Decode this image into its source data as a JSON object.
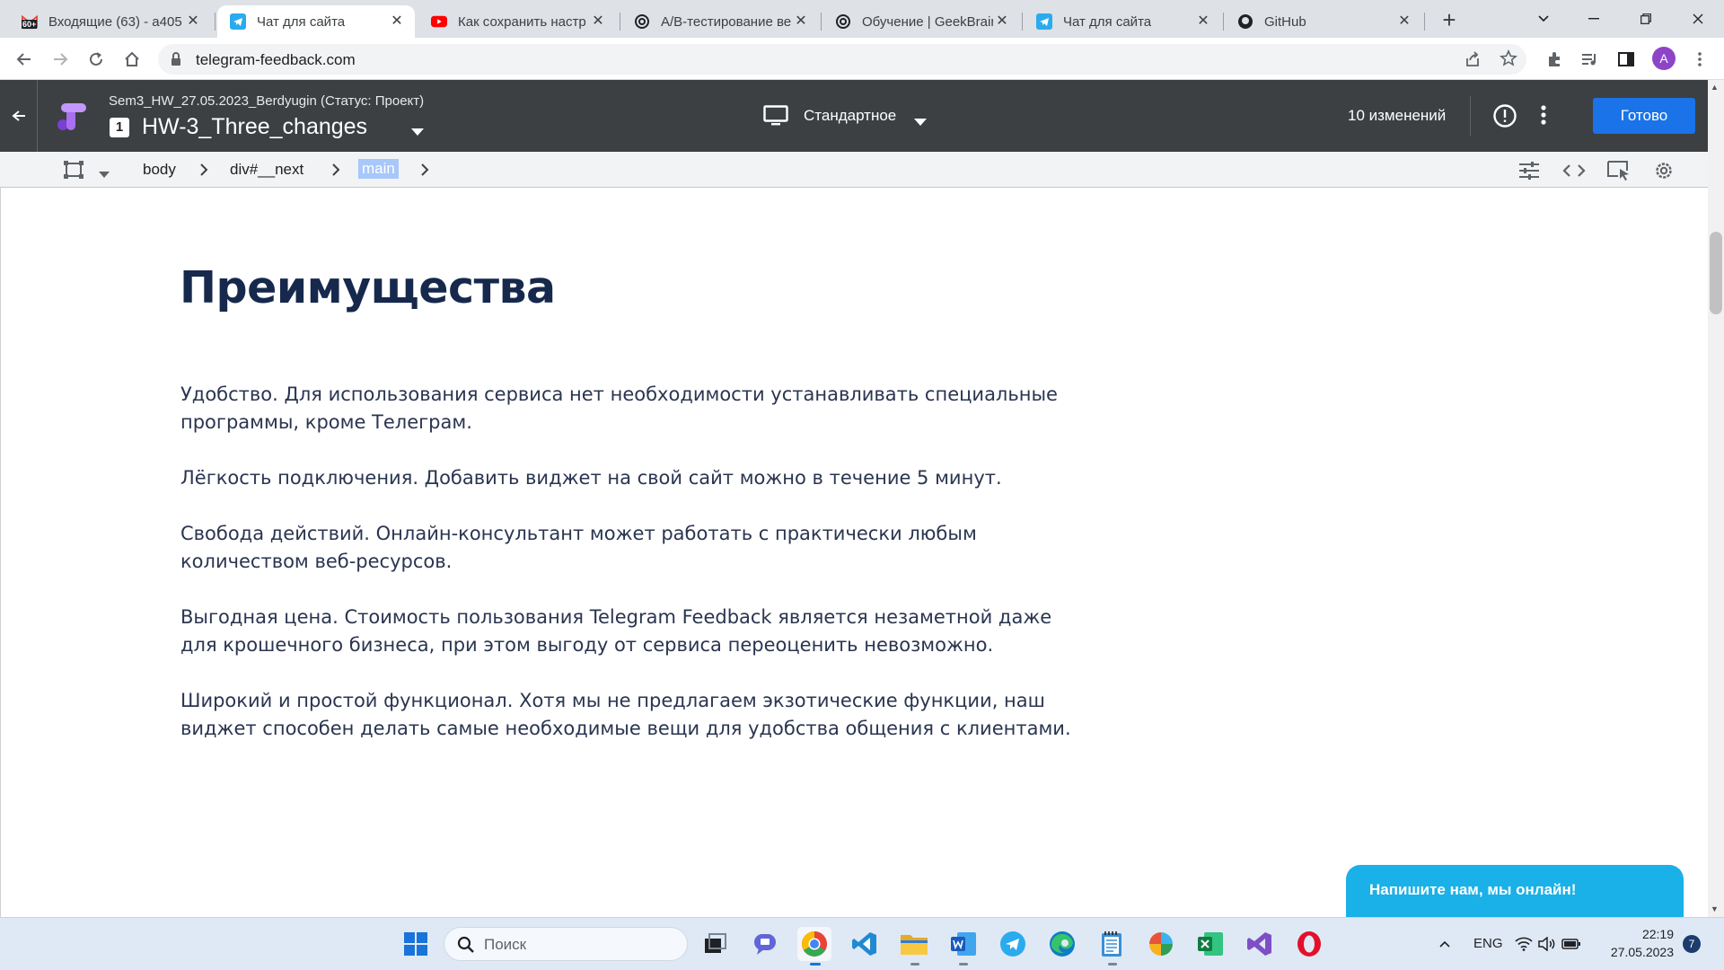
{
  "browser": {
    "tabs": [
      {
        "title": "Входящие (63) - a405",
        "favicon": "gmail-icon",
        "badge": "60+",
        "active": false
      },
      {
        "title": "Чат для сайта",
        "favicon": "telegram-icon",
        "active": true
      },
      {
        "title": "Как сохранить настр",
        "favicon": "youtube-icon",
        "active": false
      },
      {
        "title": "A/B-тестирование ве",
        "favicon": "openai-icon",
        "active": false
      },
      {
        "title": "Обучение | GeekBrain",
        "favicon": "openai-icon",
        "active": false
      },
      {
        "title": "Чат для сайта",
        "favicon": "telegram-icon",
        "active": false
      },
      {
        "title": "GitHub",
        "favicon": "github-icon",
        "active": false
      }
    ],
    "new_tab": "+",
    "url": "telegram-feedback.com",
    "profile_initial": "A"
  },
  "gtm": {
    "workspace_title": "Sem3_HW_27.05.2023_Berdyugin (Статус: Проект)",
    "version_number": "1",
    "version_name": "HW-3_Three_changes",
    "device_label": "Стандартное",
    "changes_label": "10 изменений",
    "done_label": "Готово"
  },
  "breadcrumb": {
    "items": [
      "body",
      "div#__next",
      "main"
    ]
  },
  "page": {
    "heading": "Преимущества",
    "paragraphs": [
      "Удобство. Для использования сервиса нет необходимости устанавливать специальные программы, кроме Телеграм.",
      "Лёгкость подключения. Добавить виджет на свой сайт можно в течение 5 минут.",
      "Свобода действий. Онлайн-консультант может работать с практически любым количеством веб-ресурсов.",
      "Выгодная цена. Стоимость пользования Telegram Feedback является незаметной даже для крошечного бизнеса, при этом выгоду от сервиса переоценить невозможно.",
      "Широкий и простой функционал. Хотя мы не предлагаем экзотические функции, наш виджет способен делать самые необходимые вещи для удобства общения с клиентами."
    ],
    "chat_widget": "Напишите нам, мы онлайн!"
  },
  "taskbar": {
    "search_placeholder": "Поиск",
    "language": "ENG",
    "time": "22:19",
    "date": "27.05.2023",
    "notifications": "7"
  },
  "colors": {
    "heading": "#16294d",
    "text": "#2a3550",
    "accent_blue": "#1a73e8",
    "chat_widget": "#1ab0e8",
    "gtm_header": "#3c4043"
  }
}
